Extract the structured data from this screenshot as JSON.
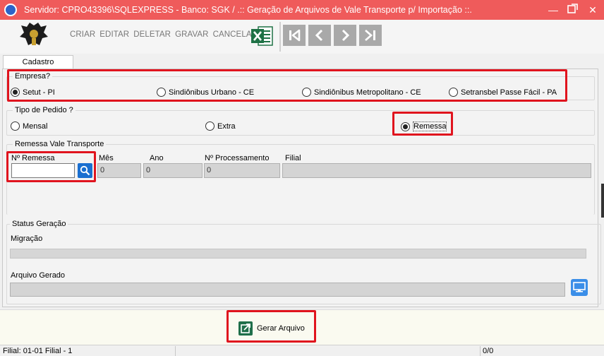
{
  "window": {
    "title": "Servidor: CPRO43396\\SQLEXPRESS - Banco: SGK / .::  Geração de Arquivos de Vale Transporte p/ Importação ::."
  },
  "toolbar": {
    "criar": "CRIAR",
    "editar": "EDITAR",
    "deletar": "DELETAR",
    "gravar": "GRAVAR",
    "cancelar": "CANCELAR"
  },
  "tabs": [
    {
      "label": "Cadastro",
      "active": true
    }
  ],
  "empresa": {
    "legend": "Empresa?",
    "options": [
      {
        "label": "Setut - PI",
        "checked": true
      },
      {
        "label": "Sindiônibus Urbano - CE",
        "checked": false
      },
      {
        "label": "Sindiônibus Metropolitano - CE",
        "checked": false
      },
      {
        "label": "Setransbel Passe Fácil - PA",
        "checked": false
      }
    ]
  },
  "tipo_pedido": {
    "legend": "Tipo de Pedido ?",
    "options": [
      {
        "label": "Mensal",
        "checked": false
      },
      {
        "label": "Extra",
        "checked": false
      },
      {
        "label": "Remessa",
        "checked": true
      }
    ]
  },
  "remessa": {
    "legend": "Remessa Vale Transporte",
    "fields": {
      "nro_remessa": {
        "label": "Nº Remessa",
        "value": ""
      },
      "mes": {
        "label": "Mês",
        "value": "0"
      },
      "ano": {
        "label": "Ano",
        "value": "0"
      },
      "nro_processamento": {
        "label": "Nº Processamento",
        "value": "0"
      },
      "filial": {
        "label": "Filial",
        "value": ""
      }
    }
  },
  "status": {
    "legend": "Status Geração",
    "migracao_label": "Migração",
    "arquivo_label": "Arquivo Gerado",
    "migracao_progress": 0
  },
  "footer": {
    "gerar_label": "Gerar Arquivo"
  },
  "statusbar": {
    "filial": "Filial: 01-01 Filial - 1",
    "count": "0/0"
  },
  "colors": {
    "title_bar": "#ef5b5b",
    "highlight": "#e0141e",
    "search_button": "#1a6fd0",
    "excel": "#1e7145"
  }
}
